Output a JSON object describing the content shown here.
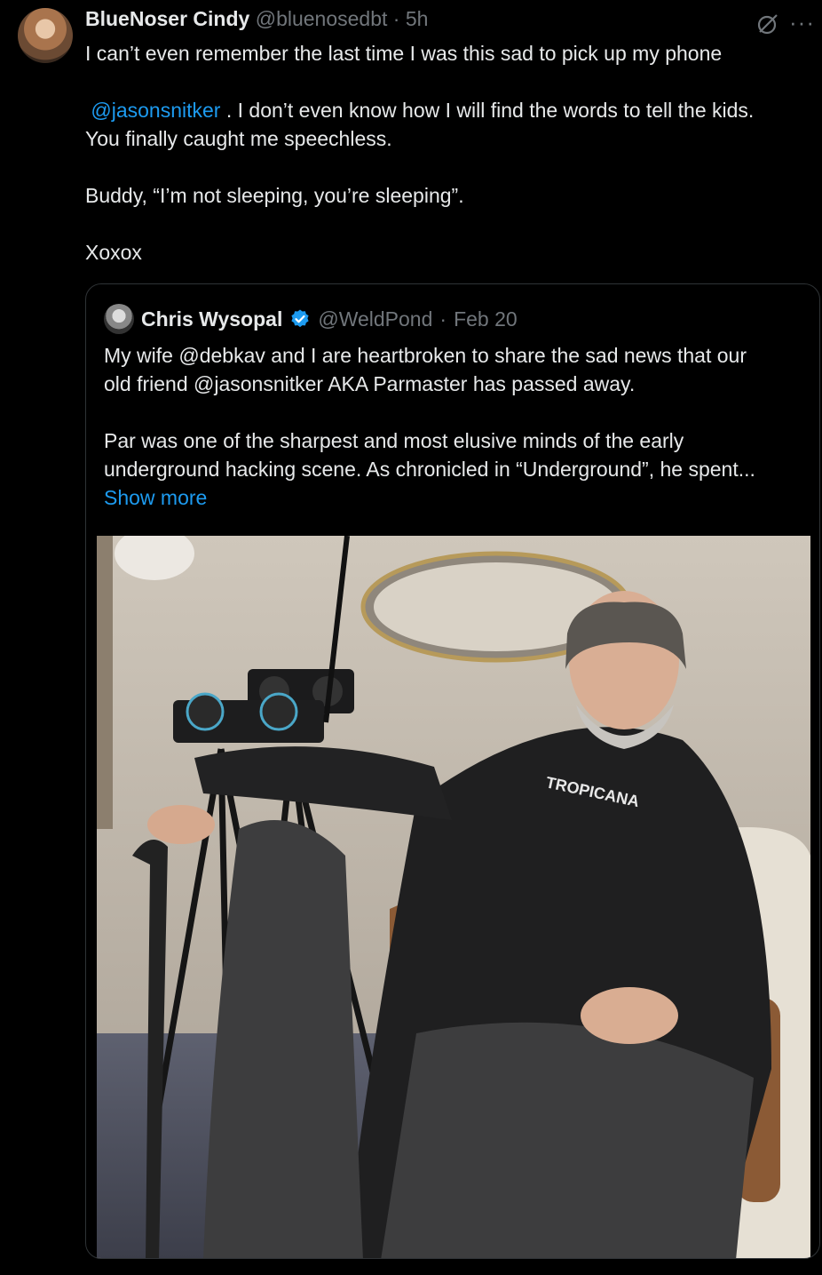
{
  "tweet": {
    "author_name": "BlueNoser Cindy",
    "author_handle": "@bluenosedbt",
    "separator": "·",
    "time": "5h",
    "more_icon": "more-icon",
    "line1": "I can’t even remember the last time I was this sad to pick up my phone",
    "mention": "@jasonsnitker",
    "line2_rest": ". I don’t even know how I will find the words to tell the kids.",
    "line3": "You finally caught me speechless.",
    "line4": "Buddy, “I’m not sleeping, you’re sleeping”.",
    "line5": "Xoxox"
  },
  "quote": {
    "author_name": "Chris Wysopal",
    "verified_icon": "verified-badge-icon",
    "author_handle": "@WeldPond",
    "separator": "·",
    "date": "Feb 20",
    "p1_line1": "My wife @debkav and I are heartbroken to share the sad news that our",
    "p1_line2": "old friend @jasonsnitker AKA Parmaster has passed away.",
    "p2_line1": "Par was one of the sharpest and most elusive minds of the early",
    "p2_line2": "underground hacking scene. As chronicled in “Underground”, he spent...",
    "show_more": "Show more",
    "photo_text": "TROPICANA"
  },
  "colors": {
    "background": "#000000",
    "text": "#e7e9ea",
    "muted": "#71767b",
    "link": "#1d9bf0",
    "border": "#2f3336"
  }
}
